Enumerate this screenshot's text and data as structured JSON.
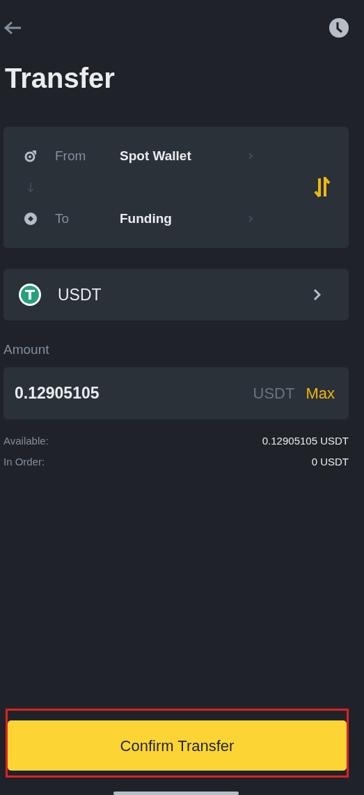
{
  "header": {
    "title": "Transfer"
  },
  "route": [
    {
      "kind": "from",
      "label": "From",
      "wallet": "Spot Wallet"
    },
    {
      "kind": "to",
      "label": "To",
      "wallet": "Funding"
    }
  ],
  "coin": {
    "symbol": "USDT"
  },
  "amount": {
    "label": "Amount",
    "value": "0.12905105",
    "unit": "USDT",
    "max": "Max"
  },
  "balances": [
    {
      "label": "Available:",
      "value": "0.12905105 USDT"
    },
    {
      "label": "In Order:",
      "value": "0 USDT"
    }
  ],
  "confirm": {
    "label": "Confirm Transfer",
    "highlighted": true
  }
}
